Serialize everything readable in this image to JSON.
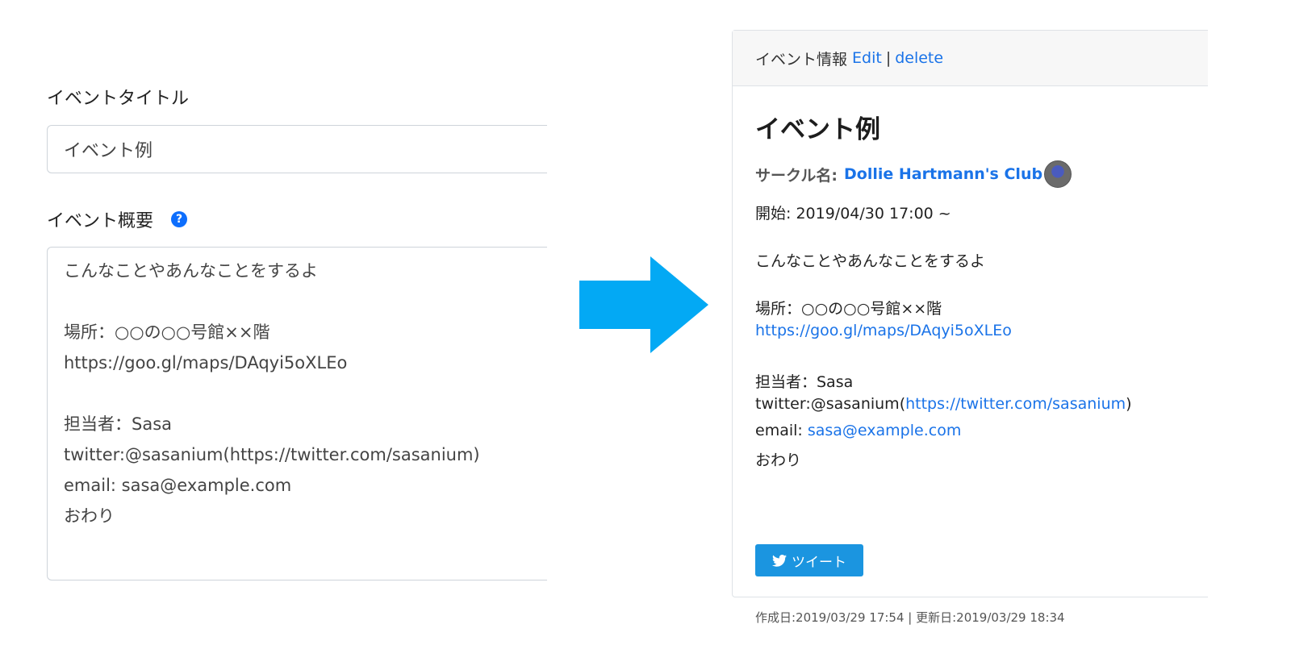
{
  "form": {
    "title_label": "イベントタイトル",
    "title_value": "イベント例",
    "summary_label": "イベント概要",
    "help_glyph": "?",
    "summary_lines": [
      "こんなことやあんなことをするよ",
      "",
      "場所：○○の○○号館××階",
      "https://goo.gl/maps/DAqyi5oXLEo",
      "",
      "担当者：Sasa",
      "twitter:@sasanium(https://twitter.com/sasanium)",
      "email: sasa@example.com",
      "おわり"
    ]
  },
  "arrow": {
    "color": "#03a9f4"
  },
  "card": {
    "header_title": "イベント情報",
    "edit_label": "Edit",
    "separator": "|",
    "delete_label": "delete",
    "event_title": "イベント例",
    "circle_label": "サークル名:",
    "circle_name": "Dollie Hartmann's Club",
    "start_text": "開始: 2019/04/30 17:00 ~",
    "description": "こんなことやあんなことをするよ",
    "place_text": "場所：○○の○○号館××階",
    "map_link": "https://goo.gl/maps/DAqyi5oXLEo",
    "person_text": "担当者：Sasa",
    "twitter_prefix": "twitter:@sasanium(",
    "twitter_link": "https://twitter.com/sasanium",
    "twitter_suffix": ")",
    "email_prefix": "email: ",
    "email_link": "sasa@example.com",
    "closing": "おわり",
    "tweet_label": "ツイート",
    "meta_text": "作成日:2019/03/29 17:54 | 更新日:2019/03/29 18:34",
    "link_color": "#1a73e8",
    "tweet_color": "#1b95e0"
  }
}
